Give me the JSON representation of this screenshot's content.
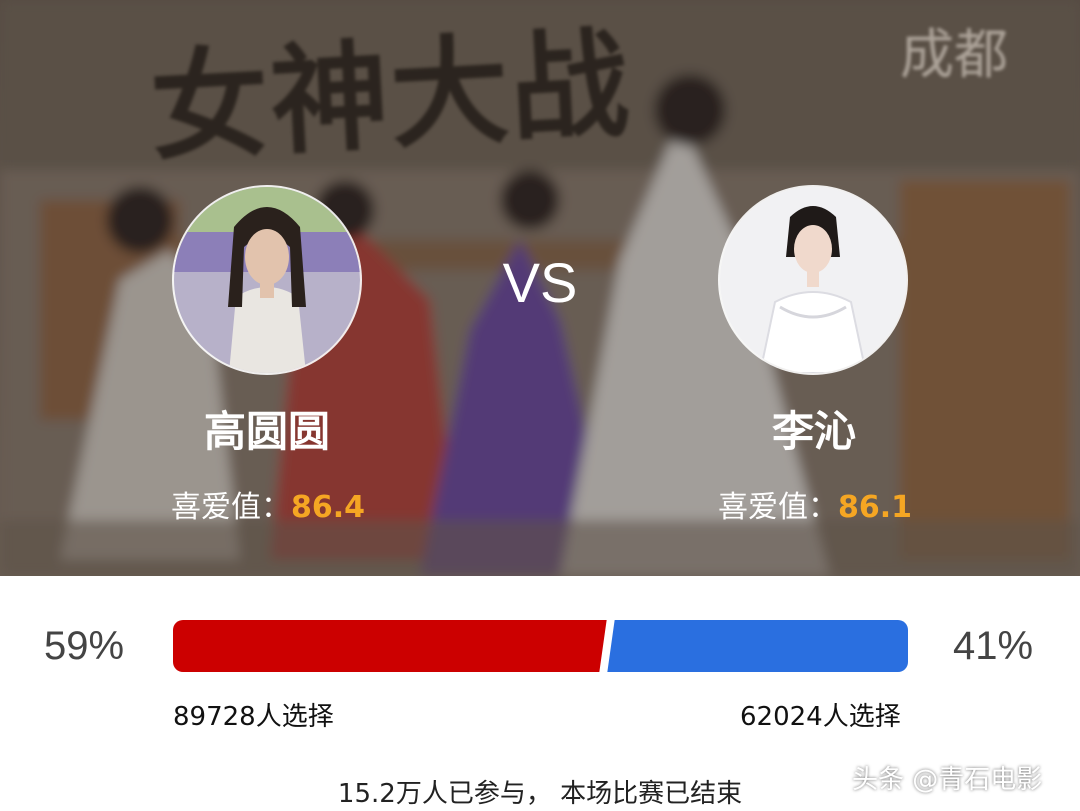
{
  "banner": {
    "title_art": "女神大战",
    "seal_art": "成都",
    "vs_label": "VS"
  },
  "contestants": {
    "left": {
      "name": "高圆圆",
      "score_label": "喜爱值：",
      "score_value": "86.4",
      "percent": "59%",
      "votes": "89728人选择"
    },
    "right": {
      "name": "李沁",
      "score_label": "喜爱值：",
      "score_value": "86.1",
      "percent": "41%",
      "votes": "62024人选择"
    }
  },
  "vote_bar": {
    "left_fraction": 0.59,
    "right_fraction": 0.41
  },
  "summary": "15.2万人已参与， 本场比赛已结束",
  "watermark": "头条 @青石电影",
  "colors": {
    "left_bar": "#cc0000",
    "right_bar": "#2a6fe0",
    "score_value": "#f5a623",
    "banner_text": "#ffffff"
  }
}
